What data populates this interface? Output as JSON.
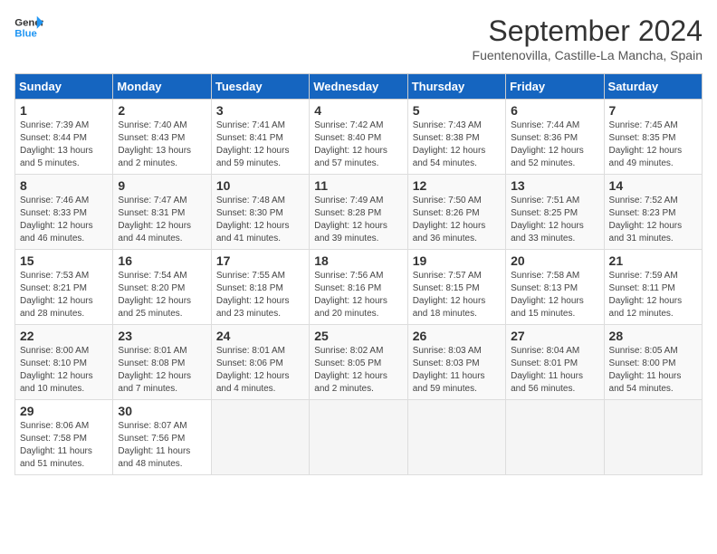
{
  "header": {
    "logo_line1": "General",
    "logo_line2": "Blue",
    "month": "September 2024",
    "location": "Fuentenovilla, Castille-La Mancha, Spain"
  },
  "weekdays": [
    "Sunday",
    "Monday",
    "Tuesday",
    "Wednesday",
    "Thursday",
    "Friday",
    "Saturday"
  ],
  "weeks": [
    [
      {
        "day": 1,
        "info": "Sunrise: 7:39 AM\nSunset: 8:44 PM\nDaylight: 13 hours\nand 5 minutes."
      },
      {
        "day": 2,
        "info": "Sunrise: 7:40 AM\nSunset: 8:43 PM\nDaylight: 13 hours\nand 2 minutes."
      },
      {
        "day": 3,
        "info": "Sunrise: 7:41 AM\nSunset: 8:41 PM\nDaylight: 12 hours\nand 59 minutes."
      },
      {
        "day": 4,
        "info": "Sunrise: 7:42 AM\nSunset: 8:40 PM\nDaylight: 12 hours\nand 57 minutes."
      },
      {
        "day": 5,
        "info": "Sunrise: 7:43 AM\nSunset: 8:38 PM\nDaylight: 12 hours\nand 54 minutes."
      },
      {
        "day": 6,
        "info": "Sunrise: 7:44 AM\nSunset: 8:36 PM\nDaylight: 12 hours\nand 52 minutes."
      },
      {
        "day": 7,
        "info": "Sunrise: 7:45 AM\nSunset: 8:35 PM\nDaylight: 12 hours\nand 49 minutes."
      }
    ],
    [
      {
        "day": 8,
        "info": "Sunrise: 7:46 AM\nSunset: 8:33 PM\nDaylight: 12 hours\nand 46 minutes."
      },
      {
        "day": 9,
        "info": "Sunrise: 7:47 AM\nSunset: 8:31 PM\nDaylight: 12 hours\nand 44 minutes."
      },
      {
        "day": 10,
        "info": "Sunrise: 7:48 AM\nSunset: 8:30 PM\nDaylight: 12 hours\nand 41 minutes."
      },
      {
        "day": 11,
        "info": "Sunrise: 7:49 AM\nSunset: 8:28 PM\nDaylight: 12 hours\nand 39 minutes."
      },
      {
        "day": 12,
        "info": "Sunrise: 7:50 AM\nSunset: 8:26 PM\nDaylight: 12 hours\nand 36 minutes."
      },
      {
        "day": 13,
        "info": "Sunrise: 7:51 AM\nSunset: 8:25 PM\nDaylight: 12 hours\nand 33 minutes."
      },
      {
        "day": 14,
        "info": "Sunrise: 7:52 AM\nSunset: 8:23 PM\nDaylight: 12 hours\nand 31 minutes."
      }
    ],
    [
      {
        "day": 15,
        "info": "Sunrise: 7:53 AM\nSunset: 8:21 PM\nDaylight: 12 hours\nand 28 minutes."
      },
      {
        "day": 16,
        "info": "Sunrise: 7:54 AM\nSunset: 8:20 PM\nDaylight: 12 hours\nand 25 minutes."
      },
      {
        "day": 17,
        "info": "Sunrise: 7:55 AM\nSunset: 8:18 PM\nDaylight: 12 hours\nand 23 minutes."
      },
      {
        "day": 18,
        "info": "Sunrise: 7:56 AM\nSunset: 8:16 PM\nDaylight: 12 hours\nand 20 minutes."
      },
      {
        "day": 19,
        "info": "Sunrise: 7:57 AM\nSunset: 8:15 PM\nDaylight: 12 hours\nand 18 minutes."
      },
      {
        "day": 20,
        "info": "Sunrise: 7:58 AM\nSunset: 8:13 PM\nDaylight: 12 hours\nand 15 minutes."
      },
      {
        "day": 21,
        "info": "Sunrise: 7:59 AM\nSunset: 8:11 PM\nDaylight: 12 hours\nand 12 minutes."
      }
    ],
    [
      {
        "day": 22,
        "info": "Sunrise: 8:00 AM\nSunset: 8:10 PM\nDaylight: 12 hours\nand 10 minutes."
      },
      {
        "day": 23,
        "info": "Sunrise: 8:01 AM\nSunset: 8:08 PM\nDaylight: 12 hours\nand 7 minutes."
      },
      {
        "day": 24,
        "info": "Sunrise: 8:01 AM\nSunset: 8:06 PM\nDaylight: 12 hours\nand 4 minutes."
      },
      {
        "day": 25,
        "info": "Sunrise: 8:02 AM\nSunset: 8:05 PM\nDaylight: 12 hours\nand 2 minutes."
      },
      {
        "day": 26,
        "info": "Sunrise: 8:03 AM\nSunset: 8:03 PM\nDaylight: 11 hours\nand 59 minutes."
      },
      {
        "day": 27,
        "info": "Sunrise: 8:04 AM\nSunset: 8:01 PM\nDaylight: 11 hours\nand 56 minutes."
      },
      {
        "day": 28,
        "info": "Sunrise: 8:05 AM\nSunset: 8:00 PM\nDaylight: 11 hours\nand 54 minutes."
      }
    ],
    [
      {
        "day": 29,
        "info": "Sunrise: 8:06 AM\nSunset: 7:58 PM\nDaylight: 11 hours\nand 51 minutes."
      },
      {
        "day": 30,
        "info": "Sunrise: 8:07 AM\nSunset: 7:56 PM\nDaylight: 11 hours\nand 48 minutes."
      },
      null,
      null,
      null,
      null,
      null
    ]
  ]
}
